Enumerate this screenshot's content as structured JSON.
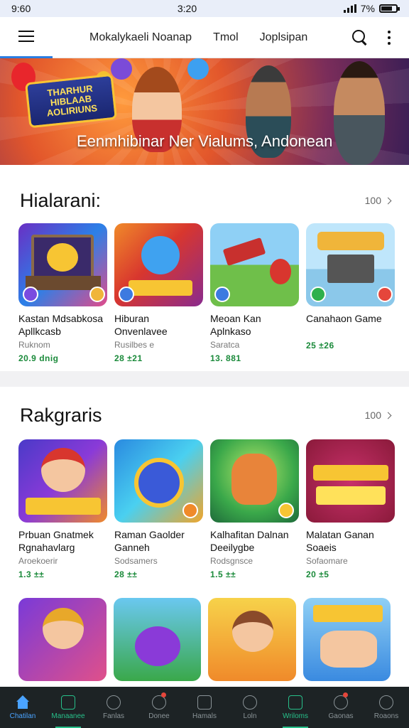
{
  "status": {
    "time_left": "9:60",
    "time_center": "3:20",
    "battery": "7%"
  },
  "nav": {
    "links": [
      "Mokalykaeli Noanap",
      "Tmol",
      "Joplsipan"
    ]
  },
  "banner": {
    "logo_text": "THARHUR HIBLAAB AOLIRIUNS",
    "caption": "Eenmhibinar Ner Vialums, Andonean"
  },
  "section1": {
    "title": "Hialarani:",
    "more": "100",
    "apps": [
      {
        "name": "Kastan Mdsabkosa Apllkcasb",
        "developer": "Ruknom",
        "rating": "20.9 dnig"
      },
      {
        "name": "Hiburan Onvenlavee",
        "developer": "Rusilbes e",
        "rating": "28 ±21"
      },
      {
        "name": "Meoan Kan Aplnkaso",
        "developer": "Saratca",
        "rating": "13. 881"
      },
      {
        "name": "Canahaon Game",
        "developer": "",
        "rating": "25 ±26"
      }
    ]
  },
  "section2": {
    "title": "Rakgraris",
    "more": "100",
    "apps": [
      {
        "name": "Prbuan Gnatmek Rgnahavlarg",
        "developer": "Aroekoerir",
        "rating": "1.3 ±±"
      },
      {
        "name": "Raman Gaolder Ganneh",
        "developer": "Sodsamers",
        "rating": "28 ±±"
      },
      {
        "name": "Kalhafitan Dalnan Deeilygbe",
        "developer": "Rodsgnsce",
        "rating": "1.5 ±±"
      },
      {
        "name": "Malatan Ganan Soaeis",
        "developer": "Sofaomare",
        "rating": "20 ±5"
      }
    ]
  },
  "tabs": [
    {
      "label": "Chatilan",
      "state": "active"
    },
    {
      "label": "Manaanee",
      "state": "highlight"
    },
    {
      "label": "Fanlas",
      "state": ""
    },
    {
      "label": "Donee",
      "state": "dot"
    },
    {
      "label": "Hamals",
      "state": ""
    },
    {
      "label": "Loln",
      "state": ""
    },
    {
      "label": "Wriloms",
      "state": "highlight2"
    },
    {
      "label": "Gaonas",
      "state": "dot"
    },
    {
      "label": "Roaons",
      "state": ""
    }
  ],
  "colors": {
    "accent": "#2a7de1",
    "rating": "#1a8a3a",
    "tabbar": "#1d2325"
  }
}
